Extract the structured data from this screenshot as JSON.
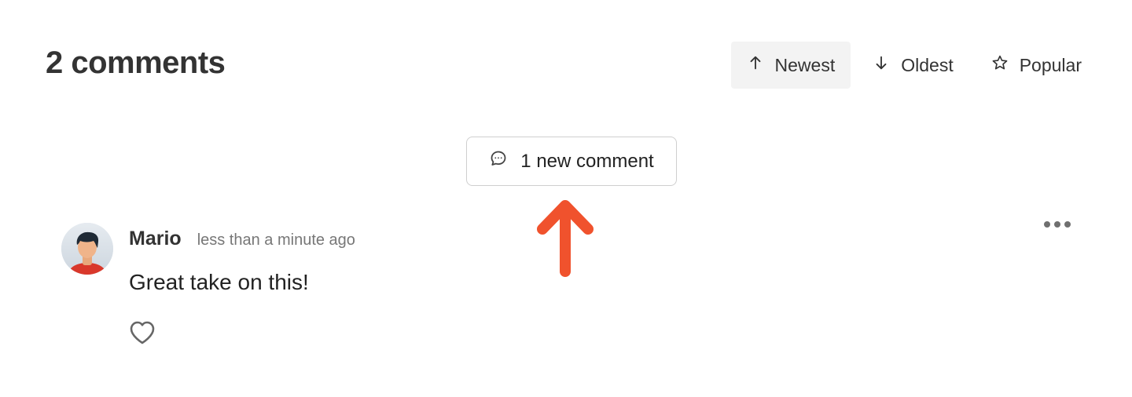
{
  "header": {
    "title": "2 comments"
  },
  "sort": {
    "options": [
      {
        "label": "Newest",
        "icon": "arrow-up-icon",
        "active": true
      },
      {
        "label": "Oldest",
        "icon": "arrow-down-icon",
        "active": false
      },
      {
        "label": "Popular",
        "icon": "star-icon",
        "active": false
      }
    ]
  },
  "new_comments": {
    "label": "1 new comment",
    "icon": "speech-bubble-icon"
  },
  "annotation": {
    "icon": "arrow-up-annotation",
    "color": "#f0522d"
  },
  "comments": [
    {
      "author": "Mario",
      "time": "less than a minute ago",
      "text": "Great take on this!",
      "avatar_icon": "avatar",
      "like_icon": "heart-icon",
      "menu_icon": "more-horizontal-icon"
    }
  ]
}
